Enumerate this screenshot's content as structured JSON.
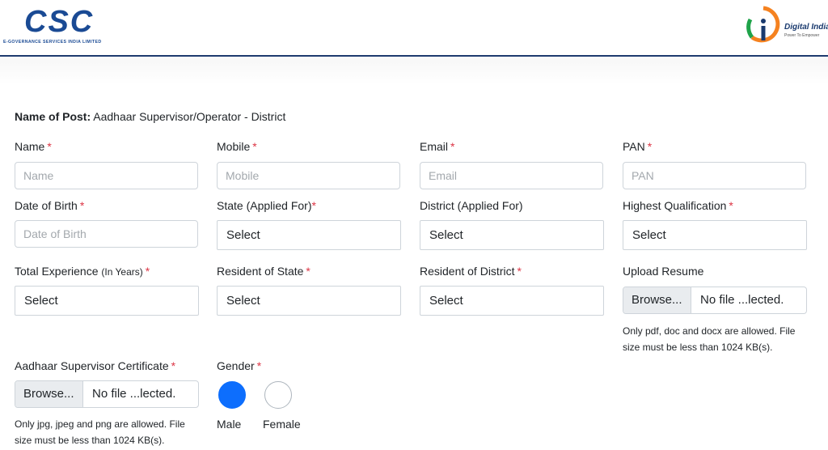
{
  "header": {
    "csc_logo_text": "CSC",
    "csc_logo_sub": "E-GOVERNANCE SERVICES INDIA LIMITED",
    "di_logo_text": "Digital India",
    "di_logo_sub": "Power To Empower"
  },
  "post": {
    "label": "Name of Post:",
    "value": "Aadhaar Supervisor/Operator - District"
  },
  "required_mark": "*",
  "fields": {
    "name": {
      "label": "Name",
      "placeholder": "Name"
    },
    "mobile": {
      "label": "Mobile",
      "placeholder": "Mobile"
    },
    "email": {
      "label": "Email",
      "placeholder": "Email"
    },
    "pan": {
      "label": "PAN",
      "placeholder": "PAN"
    },
    "dob": {
      "label": "Date of Birth",
      "placeholder": "Date of Birth"
    },
    "state": {
      "label": "State (Applied For)",
      "value": "Select"
    },
    "district": {
      "label": "District (Applied For)",
      "value": "Select"
    },
    "qualification": {
      "label": "Highest Qualification",
      "value": "Select"
    },
    "experience": {
      "label": "Total Experience",
      "label_small": "(In Years)",
      "value": "Select"
    },
    "resident_state": {
      "label": "Resident of State",
      "value": "Select"
    },
    "resident_district": {
      "label": "Resident of District",
      "value": "Select"
    },
    "resume": {
      "label": "Upload Resume",
      "browse": "Browse...",
      "file": "No file ...lected.",
      "help": "Only pdf, doc and docx are allowed. File size must be less than 1024 KB(s)."
    },
    "certificate": {
      "label": "Aadhaar Supervisor Certificate",
      "browse": "Browse...",
      "file": "No file ...lected.",
      "help": "Only jpg, jpeg and png are allowed. File size must be less than 1024 KB(s)."
    },
    "gender": {
      "label": "Gender",
      "options": [
        "Male",
        "Female"
      ],
      "selected": "Male"
    }
  },
  "colors": {
    "accent": "#0d6efd",
    "required": "#dc3545",
    "brand": "#1a4a94"
  }
}
